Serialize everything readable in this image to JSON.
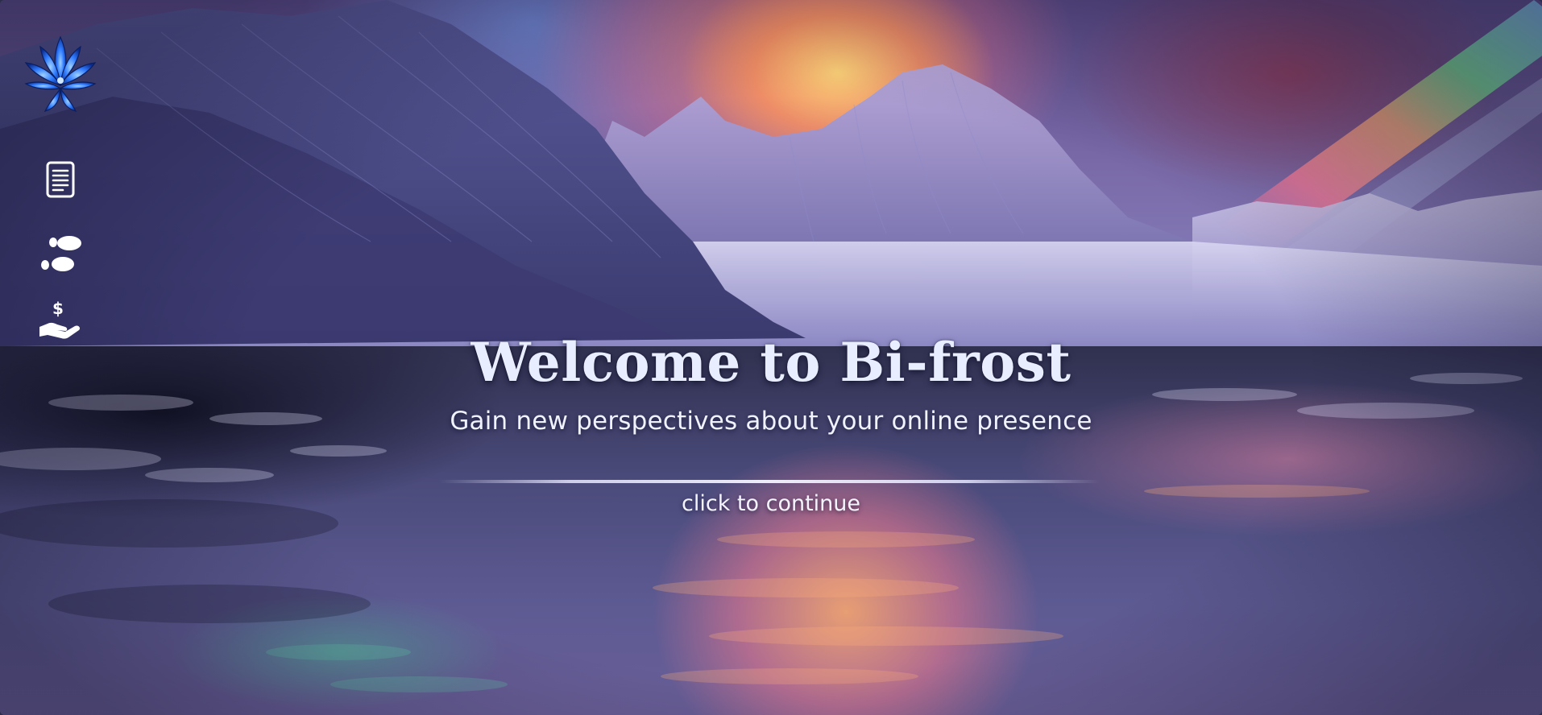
{
  "hero": {
    "title": "Welcome to Bi-frost",
    "subtitle": "Gain new perspectives about your online presence",
    "continue_label": "click to continue"
  },
  "sidebar": {
    "logo": "lotus-logo",
    "items": [
      {
        "icon": "document-icon"
      },
      {
        "icon": "footprints-icon"
      },
      {
        "icon": "hand-dollar-icon"
      }
    ]
  },
  "colors": {
    "title": "#e8edff",
    "text": "#f4f4ff",
    "logo_blue": "#2f7bff",
    "icon_white": "#ffffff"
  }
}
